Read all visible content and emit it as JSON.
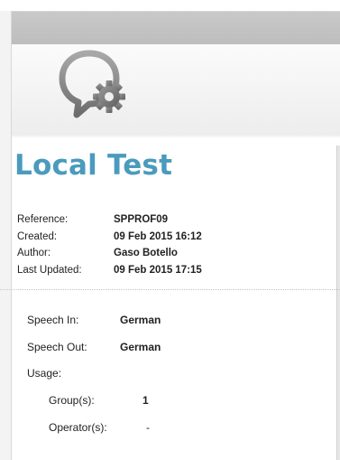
{
  "report": {
    "title": "Local Test",
    "meta": [
      {
        "label": "Reference:",
        "value": "SPPROF09"
      },
      {
        "label": "Created:",
        "value": "09 Feb 2015 16:12"
      },
      {
        "label": "Author:",
        "value": "Gaso Botello"
      },
      {
        "label": "Last Updated:",
        "value": "09 Feb 2015 17:15"
      }
    ],
    "speech_in": {
      "label": "Speech In:",
      "value": "German"
    },
    "speech_out": {
      "label": "Speech Out:",
      "value": "German"
    },
    "usage": {
      "label": "Usage:",
      "groups": {
        "label": "Group(s):",
        "value": "1"
      },
      "operators": {
        "label": "Operator(s):",
        "value": "-"
      }
    }
  },
  "colors": {
    "title": "#4a9bbd",
    "header_bar": "#c4c4c4",
    "logo_gray": "#8a8a8a"
  },
  "icons": {
    "logo": "speech-bubble-gear-icon"
  }
}
